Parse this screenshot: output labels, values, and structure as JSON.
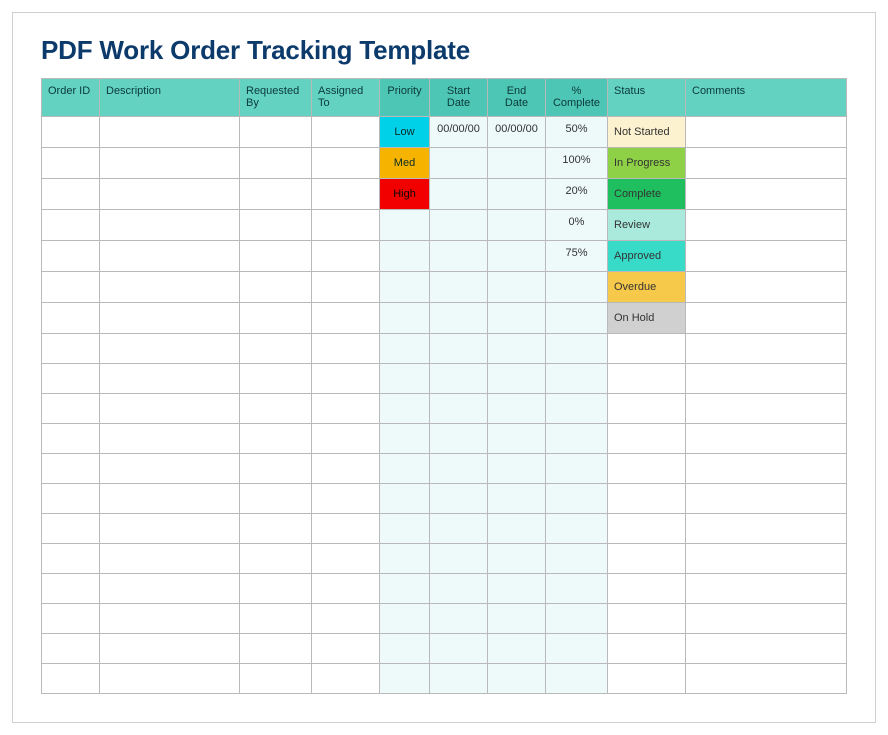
{
  "title": "PDF Work Order Tracking Template",
  "headers": {
    "order_id": "Order ID",
    "description": "Description",
    "requested_by": "Requested By",
    "assigned_to": "Assigned To",
    "priority": "Priority",
    "start_date": "Start Date",
    "end_date": "End Date",
    "pct_complete": "% Complete",
    "status": "Status",
    "comments": "Comments"
  },
  "rows": [
    {
      "order_id": "",
      "description": "",
      "requested_by": "",
      "assigned_to": "",
      "priority": "Low",
      "priority_class": "priority-low",
      "start_date": "00/00/00",
      "end_date": "00/00/00",
      "pct_complete": "50%",
      "status": "Not Started",
      "status_class": "status-notstarted",
      "comments": ""
    },
    {
      "order_id": "",
      "description": "",
      "requested_by": "",
      "assigned_to": "",
      "priority": "Med",
      "priority_class": "priority-med",
      "start_date": "",
      "end_date": "",
      "pct_complete": "100%",
      "status": "In Progress",
      "status_class": "status-inprogress",
      "comments": ""
    },
    {
      "order_id": "",
      "description": "",
      "requested_by": "",
      "assigned_to": "",
      "priority": "High",
      "priority_class": "priority-high",
      "start_date": "",
      "end_date": "",
      "pct_complete": "20%",
      "status": "Complete",
      "status_class": "status-complete",
      "comments": ""
    },
    {
      "order_id": "",
      "description": "",
      "requested_by": "",
      "assigned_to": "",
      "priority": "",
      "priority_class": "",
      "start_date": "",
      "end_date": "",
      "pct_complete": "0%",
      "status": "Review",
      "status_class": "status-review",
      "comments": ""
    },
    {
      "order_id": "",
      "description": "",
      "requested_by": "",
      "assigned_to": "",
      "priority": "",
      "priority_class": "",
      "start_date": "",
      "end_date": "",
      "pct_complete": "75%",
      "status": "Approved",
      "status_class": "status-approved",
      "comments": ""
    },
    {
      "order_id": "",
      "description": "",
      "requested_by": "",
      "assigned_to": "",
      "priority": "",
      "priority_class": "",
      "start_date": "",
      "end_date": "",
      "pct_complete": "",
      "status": "Overdue",
      "status_class": "status-overdue",
      "comments": ""
    },
    {
      "order_id": "",
      "description": "",
      "requested_by": "",
      "assigned_to": "",
      "priority": "",
      "priority_class": "",
      "start_date": "",
      "end_date": "",
      "pct_complete": "",
      "status": "On Hold",
      "status_class": "status-onhold",
      "comments": ""
    },
    {
      "order_id": "",
      "description": "",
      "requested_by": "",
      "assigned_to": "",
      "priority": "",
      "priority_class": "",
      "start_date": "",
      "end_date": "",
      "pct_complete": "",
      "status": "",
      "status_class": "",
      "comments": ""
    },
    {
      "order_id": "",
      "description": "",
      "requested_by": "",
      "assigned_to": "",
      "priority": "",
      "priority_class": "",
      "start_date": "",
      "end_date": "",
      "pct_complete": "",
      "status": "",
      "status_class": "",
      "comments": ""
    },
    {
      "order_id": "",
      "description": "",
      "requested_by": "",
      "assigned_to": "",
      "priority": "",
      "priority_class": "",
      "start_date": "",
      "end_date": "",
      "pct_complete": "",
      "status": "",
      "status_class": "",
      "comments": ""
    },
    {
      "order_id": "",
      "description": "",
      "requested_by": "",
      "assigned_to": "",
      "priority": "",
      "priority_class": "",
      "start_date": "",
      "end_date": "",
      "pct_complete": "",
      "status": "",
      "status_class": "",
      "comments": ""
    },
    {
      "order_id": "",
      "description": "",
      "requested_by": "",
      "assigned_to": "",
      "priority": "",
      "priority_class": "",
      "start_date": "",
      "end_date": "",
      "pct_complete": "",
      "status": "",
      "status_class": "",
      "comments": ""
    },
    {
      "order_id": "",
      "description": "",
      "requested_by": "",
      "assigned_to": "",
      "priority": "",
      "priority_class": "",
      "start_date": "",
      "end_date": "",
      "pct_complete": "",
      "status": "",
      "status_class": "",
      "comments": ""
    },
    {
      "order_id": "",
      "description": "",
      "requested_by": "",
      "assigned_to": "",
      "priority": "",
      "priority_class": "",
      "start_date": "",
      "end_date": "",
      "pct_complete": "",
      "status": "",
      "status_class": "",
      "comments": ""
    },
    {
      "order_id": "",
      "description": "",
      "requested_by": "",
      "assigned_to": "",
      "priority": "",
      "priority_class": "",
      "start_date": "",
      "end_date": "",
      "pct_complete": "",
      "status": "",
      "status_class": "",
      "comments": ""
    },
    {
      "order_id": "",
      "description": "",
      "requested_by": "",
      "assigned_to": "",
      "priority": "",
      "priority_class": "",
      "start_date": "",
      "end_date": "",
      "pct_complete": "",
      "status": "",
      "status_class": "",
      "comments": ""
    },
    {
      "order_id": "",
      "description": "",
      "requested_by": "",
      "assigned_to": "",
      "priority": "",
      "priority_class": "",
      "start_date": "",
      "end_date": "",
      "pct_complete": "",
      "status": "",
      "status_class": "",
      "comments": ""
    },
    {
      "order_id": "",
      "description": "",
      "requested_by": "",
      "assigned_to": "",
      "priority": "",
      "priority_class": "",
      "start_date": "",
      "end_date": "",
      "pct_complete": "",
      "status": "",
      "status_class": "",
      "comments": ""
    },
    {
      "order_id": "",
      "description": "",
      "requested_by": "",
      "assigned_to": "",
      "priority": "",
      "priority_class": "",
      "start_date": "",
      "end_date": "",
      "pct_complete": "",
      "status": "",
      "status_class": "",
      "comments": ""
    }
  ]
}
